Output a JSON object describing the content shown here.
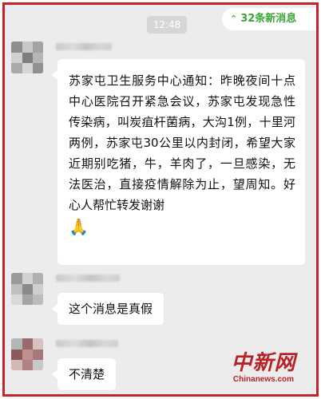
{
  "chat": {
    "time": "12:48",
    "new_messages": "32条新消息",
    "messages": [
      {
        "text": "苏家屯卫生服务中心通知：昨晚夜间十点中心医院召开紧急会议，苏家屯发现急性传染病，叫炭疽杆菌病，大沟1例，十里河两例，苏家屯30公里以内封闭，希望大家近期别吃猪，牛，羊肉了，一旦感染，无法医治，直接疫情解除为止，望周知。好心人帮忙转发谢谢",
        "emoji": "🙏"
      },
      {
        "text": "这个消息是真假"
      },
      {
        "text": "不清楚"
      }
    ]
  },
  "watermark": {
    "cn": "中新网",
    "en": "Chinanews.com"
  },
  "colors": {
    "frame_border": "#c8232c",
    "chat_background": "#ececec",
    "new_messages_text": "#3aa537",
    "watermark": "#b8232a"
  },
  "icons": {
    "new_messages_chevron": "double-chevron-up-icon",
    "emoji": "folded-hands-icon"
  }
}
